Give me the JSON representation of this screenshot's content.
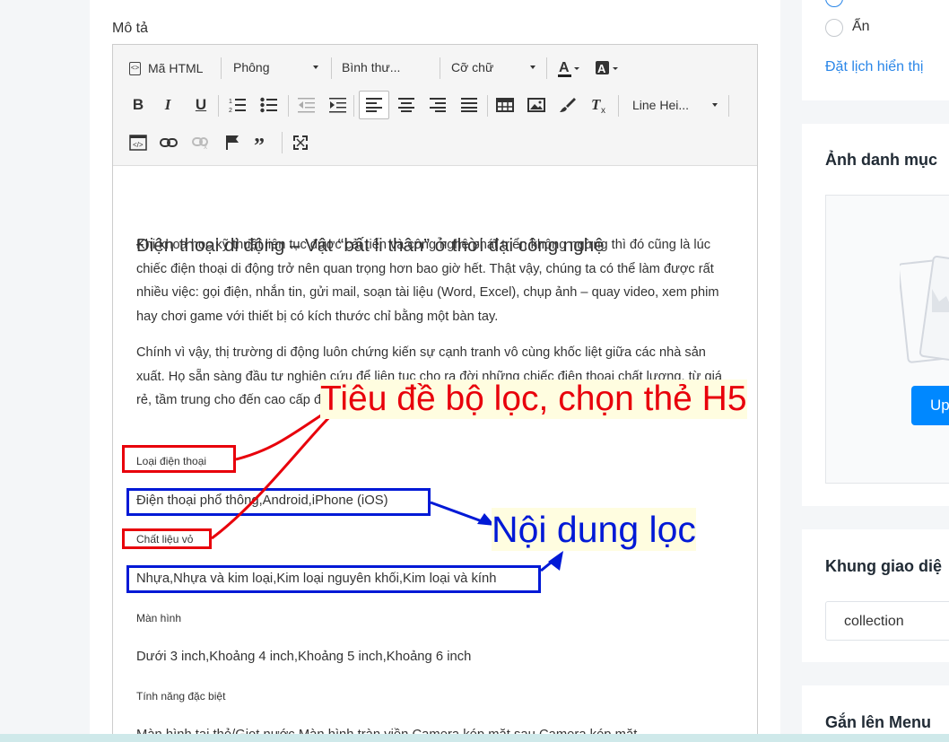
{
  "field": {
    "label": "Mô tả"
  },
  "toolbar": {
    "html_label": "Mã HTML",
    "font_family": "Phông",
    "format": "Bình thư...",
    "font_size": "Cỡ chữ",
    "line_height": "Line Hei..."
  },
  "content": {
    "heading": "Điện thoại di động – Vật “bất li thân” ở thời đại công nghệ",
    "para1": "Khi khoa học kỹ thuật liên tục được cải tiến và công nghệ phát triển không ngừng thì đó cũng là lúc chiếc điện thoại di động trở nên quan trọng hơn bao giờ hết. Thật vậy, chúng ta có thể làm được rất nhiều việc: gọi điện, nhắn tin, gửi mail, soạn tài liệu (Word, Excel), chụp ảnh – quay video, xem phim hay chơi game với thiết bị có kích thước chỉ bằng một bàn tay.",
    "para2": "Chính vì vậy, thị trường di động luôn chứng kiến sự cạnh tranh vô cùng khốc liệt giữa các nhà sản xuất. Họ sẵn sàng đầu tư nghiên cứu để liên tục cho ra đời những chiếc điện thoại chất lượng, từ giá rẻ, tầm trung cho đến cao cấp để đáp ứng nhu cầu của mọi đối tượng người dùng.",
    "filters": [
      {
        "title": "Loại điện thoại",
        "values": "Điện thoại phổ thông,Android,iPhone (iOS)"
      },
      {
        "title": "Chất liệu vỏ",
        "values": "Nhựa,Nhựa và kim loại,Kim loại nguyên khối,Kim loại và kính"
      },
      {
        "title": "Màn hình",
        "values": "Dưới 3 inch,Khoảng 4 inch,Khoảng 5 inch,Khoảng 6 inch"
      },
      {
        "title": "Tính năng đặc biệt",
        "values": "Màn hình tai thỏ/Giọt nước,Màn hình tràn viền,Camera kép mặt sau,Camera kép mặt"
      }
    ]
  },
  "sidebar": {
    "visibility_hidden": "Ẩn",
    "schedule_link": "Đặt lịch hiển thị",
    "image_title": "Ảnh danh mục",
    "upload_label": "Up",
    "template_title": "Khung giao diệ",
    "template_value": "collection",
    "menu_title": "Gắn lên Menu"
  },
  "annotations": {
    "title_note": "Tiêu đề bộ lọc, chọn thẻ H5",
    "content_note": "Nội dung lọc",
    "red": "#e8000b",
    "blue": "#0019d6"
  }
}
